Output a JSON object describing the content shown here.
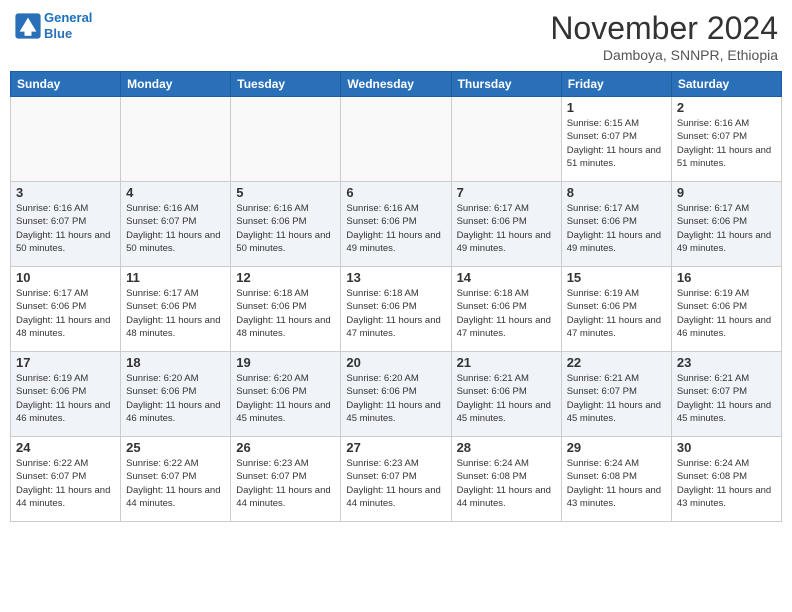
{
  "logo": {
    "line1": "General",
    "line2": "Blue"
  },
  "title": "November 2024",
  "location": "Damboya, SNNPR, Ethiopia",
  "days_of_week": [
    "Sunday",
    "Monday",
    "Tuesday",
    "Wednesday",
    "Thursday",
    "Friday",
    "Saturday"
  ],
  "weeks": [
    [
      {
        "day": "",
        "text": ""
      },
      {
        "day": "",
        "text": ""
      },
      {
        "day": "",
        "text": ""
      },
      {
        "day": "",
        "text": ""
      },
      {
        "day": "",
        "text": ""
      },
      {
        "day": "1",
        "text": "Sunrise: 6:15 AM\nSunset: 6:07 PM\nDaylight: 11 hours and 51 minutes."
      },
      {
        "day": "2",
        "text": "Sunrise: 6:16 AM\nSunset: 6:07 PM\nDaylight: 11 hours and 51 minutes."
      }
    ],
    [
      {
        "day": "3",
        "text": "Sunrise: 6:16 AM\nSunset: 6:07 PM\nDaylight: 11 hours and 50 minutes."
      },
      {
        "day": "4",
        "text": "Sunrise: 6:16 AM\nSunset: 6:07 PM\nDaylight: 11 hours and 50 minutes."
      },
      {
        "day": "5",
        "text": "Sunrise: 6:16 AM\nSunset: 6:06 PM\nDaylight: 11 hours and 50 minutes."
      },
      {
        "day": "6",
        "text": "Sunrise: 6:16 AM\nSunset: 6:06 PM\nDaylight: 11 hours and 49 minutes."
      },
      {
        "day": "7",
        "text": "Sunrise: 6:17 AM\nSunset: 6:06 PM\nDaylight: 11 hours and 49 minutes."
      },
      {
        "day": "8",
        "text": "Sunrise: 6:17 AM\nSunset: 6:06 PM\nDaylight: 11 hours and 49 minutes."
      },
      {
        "day": "9",
        "text": "Sunrise: 6:17 AM\nSunset: 6:06 PM\nDaylight: 11 hours and 49 minutes."
      }
    ],
    [
      {
        "day": "10",
        "text": "Sunrise: 6:17 AM\nSunset: 6:06 PM\nDaylight: 11 hours and 48 minutes."
      },
      {
        "day": "11",
        "text": "Sunrise: 6:17 AM\nSunset: 6:06 PM\nDaylight: 11 hours and 48 minutes."
      },
      {
        "day": "12",
        "text": "Sunrise: 6:18 AM\nSunset: 6:06 PM\nDaylight: 11 hours and 48 minutes."
      },
      {
        "day": "13",
        "text": "Sunrise: 6:18 AM\nSunset: 6:06 PM\nDaylight: 11 hours and 47 minutes."
      },
      {
        "day": "14",
        "text": "Sunrise: 6:18 AM\nSunset: 6:06 PM\nDaylight: 11 hours and 47 minutes."
      },
      {
        "day": "15",
        "text": "Sunrise: 6:19 AM\nSunset: 6:06 PM\nDaylight: 11 hours and 47 minutes."
      },
      {
        "day": "16",
        "text": "Sunrise: 6:19 AM\nSunset: 6:06 PM\nDaylight: 11 hours and 46 minutes."
      }
    ],
    [
      {
        "day": "17",
        "text": "Sunrise: 6:19 AM\nSunset: 6:06 PM\nDaylight: 11 hours and 46 minutes."
      },
      {
        "day": "18",
        "text": "Sunrise: 6:20 AM\nSunset: 6:06 PM\nDaylight: 11 hours and 46 minutes."
      },
      {
        "day": "19",
        "text": "Sunrise: 6:20 AM\nSunset: 6:06 PM\nDaylight: 11 hours and 45 minutes."
      },
      {
        "day": "20",
        "text": "Sunrise: 6:20 AM\nSunset: 6:06 PM\nDaylight: 11 hours and 45 minutes."
      },
      {
        "day": "21",
        "text": "Sunrise: 6:21 AM\nSunset: 6:06 PM\nDaylight: 11 hours and 45 minutes."
      },
      {
        "day": "22",
        "text": "Sunrise: 6:21 AM\nSunset: 6:07 PM\nDaylight: 11 hours and 45 minutes."
      },
      {
        "day": "23",
        "text": "Sunrise: 6:21 AM\nSunset: 6:07 PM\nDaylight: 11 hours and 45 minutes."
      }
    ],
    [
      {
        "day": "24",
        "text": "Sunrise: 6:22 AM\nSunset: 6:07 PM\nDaylight: 11 hours and 44 minutes."
      },
      {
        "day": "25",
        "text": "Sunrise: 6:22 AM\nSunset: 6:07 PM\nDaylight: 11 hours and 44 minutes."
      },
      {
        "day": "26",
        "text": "Sunrise: 6:23 AM\nSunset: 6:07 PM\nDaylight: 11 hours and 44 minutes."
      },
      {
        "day": "27",
        "text": "Sunrise: 6:23 AM\nSunset: 6:07 PM\nDaylight: 11 hours and 44 minutes."
      },
      {
        "day": "28",
        "text": "Sunrise: 6:24 AM\nSunset: 6:08 PM\nDaylight: 11 hours and 44 minutes."
      },
      {
        "day": "29",
        "text": "Sunrise: 6:24 AM\nSunset: 6:08 PM\nDaylight: 11 hours and 43 minutes."
      },
      {
        "day": "30",
        "text": "Sunrise: 6:24 AM\nSunset: 6:08 PM\nDaylight: 11 hours and 43 minutes."
      }
    ]
  ]
}
